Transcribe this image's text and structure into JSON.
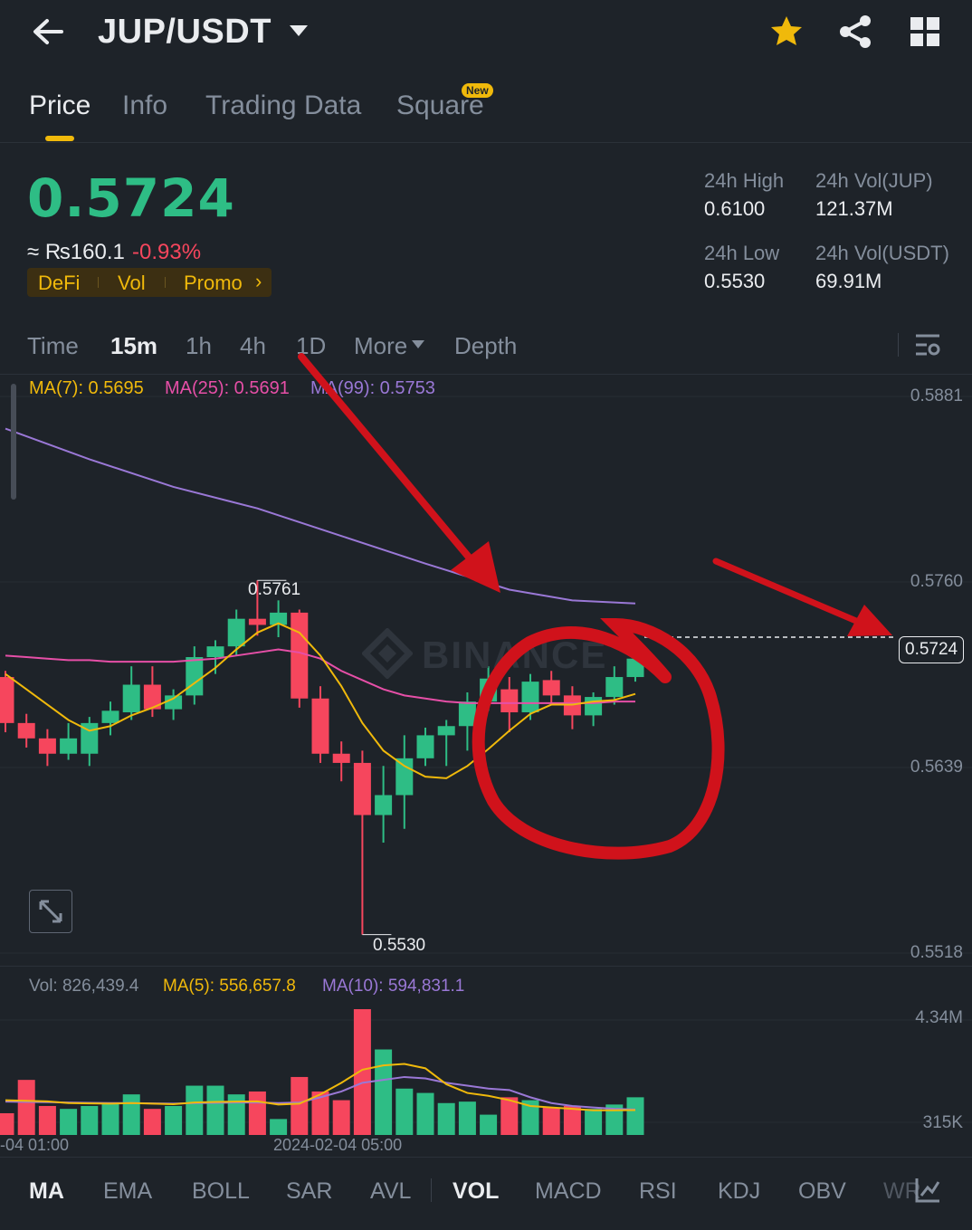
{
  "header": {
    "title": "JUP/USDT"
  },
  "tabs": [
    {
      "label": "Price",
      "active": true
    },
    {
      "label": "Info"
    },
    {
      "label": "Trading Data"
    },
    {
      "label": "Square",
      "badge": "New"
    }
  ],
  "ticker": {
    "price": "0.5724",
    "fiat": "≈ ₨160.1",
    "change": "-0.93%",
    "tags": [
      "DeFi",
      "Vol",
      "Promo"
    ],
    "high_label": "24h High",
    "high": "0.6100",
    "low_label": "24h Low",
    "low": "0.5530",
    "vol_jup_label": "24h Vol(JUP)",
    "vol_jup": "121.37M",
    "vol_usdt_label": "24h Vol(USDT)",
    "vol_usdt": "69.91M"
  },
  "timeframes": [
    "Time",
    "15m",
    "1h",
    "4h",
    "1D",
    "More",
    "Depth"
  ],
  "active_timeframe": "15m",
  "ma_legend": {
    "ma7": "MA(7): 0.5695",
    "ma25": "MA(25): 0.5691",
    "ma99": "MA(99): 0.5753"
  },
  "price_axis": [
    "0.5881",
    "0.5760",
    "0.5639",
    "0.5518"
  ],
  "current_price_tag": "0.5724",
  "high_marker": "0.5761",
  "low_marker": "0.5530",
  "watermark": "BINANCE",
  "vol_legend": {
    "vol": "Vol: 826,439.4",
    "ma5": "MA(5): 556,657.8",
    "ma10": "MA(10): 594,831.1"
  },
  "vol_axis": [
    "4.34M",
    "315K"
  ],
  "time_axis": [
    "-04 01:00",
    "2024-02-04 05:00"
  ],
  "indicators": [
    "MA",
    "EMA",
    "BOLL",
    "SAR",
    "AVL",
    "VOL",
    "MACD",
    "RSI",
    "KDJ",
    "OBV",
    "WR"
  ],
  "colors": {
    "up": "#2ebd85",
    "down": "#f6465d",
    "accent": "#f0b90b",
    "ma7": "#f0b90b",
    "ma25": "#e64fa7",
    "ma99": "#9a78d6",
    "annotation": "#d0121b"
  },
  "chart_data": {
    "type": "candlestick",
    "title": "",
    "interval": "15m",
    "ylim": [
      0.5518,
      0.5881
    ],
    "candles": [
      {
        "o": 0.5698,
        "h": 0.5702,
        "l": 0.5662,
        "c": 0.5668
      },
      {
        "o": 0.5668,
        "h": 0.5674,
        "l": 0.5652,
        "c": 0.5658
      },
      {
        "o": 0.5658,
        "h": 0.5664,
        "l": 0.564,
        "c": 0.5648
      },
      {
        "o": 0.5648,
        "h": 0.5668,
        "l": 0.5644,
        "c": 0.5658
      },
      {
        "o": 0.5648,
        "h": 0.5672,
        "l": 0.564,
        "c": 0.5668
      },
      {
        "o": 0.5668,
        "h": 0.5682,
        "l": 0.566,
        "c": 0.5676
      },
      {
        "o": 0.5675,
        "h": 0.5705,
        "l": 0.567,
        "c": 0.5693
      },
      {
        "o": 0.5693,
        "h": 0.5705,
        "l": 0.5672,
        "c": 0.5677
      },
      {
        "o": 0.5677,
        "h": 0.569,
        "l": 0.567,
        "c": 0.5686
      },
      {
        "o": 0.5686,
        "h": 0.5718,
        "l": 0.568,
        "c": 0.5711
      },
      {
        "o": 0.5711,
        "h": 0.5722,
        "l": 0.57,
        "c": 0.5718
      },
      {
        "o": 0.5718,
        "h": 0.5742,
        "l": 0.5712,
        "c": 0.5736
      },
      {
        "o": 0.5736,
        "h": 0.5761,
        "l": 0.5725,
        "c": 0.5732
      },
      {
        "o": 0.5732,
        "h": 0.5748,
        "l": 0.5724,
        "c": 0.574
      },
      {
        "o": 0.574,
        "h": 0.5742,
        "l": 0.5678,
        "c": 0.5684
      },
      {
        "o": 0.5684,
        "h": 0.5692,
        "l": 0.5642,
        "c": 0.5648
      },
      {
        "o": 0.5648,
        "h": 0.5656,
        "l": 0.563,
        "c": 0.5642
      },
      {
        "o": 0.5642,
        "h": 0.565,
        "l": 0.553,
        "c": 0.5608
      },
      {
        "o": 0.5608,
        "h": 0.564,
        "l": 0.559,
        "c": 0.5621
      },
      {
        "o": 0.5621,
        "h": 0.566,
        "l": 0.5599,
        "c": 0.5645
      },
      {
        "o": 0.5645,
        "h": 0.5665,
        "l": 0.564,
        "c": 0.566
      },
      {
        "o": 0.566,
        "h": 0.567,
        "l": 0.564,
        "c": 0.5666
      },
      {
        "o": 0.5666,
        "h": 0.5688,
        "l": 0.565,
        "c": 0.5682
      },
      {
        "o": 0.5682,
        "h": 0.5705,
        "l": 0.5676,
        "c": 0.5697
      },
      {
        "o": 0.569,
        "h": 0.5698,
        "l": 0.5662,
        "c": 0.5675
      },
      {
        "o": 0.5675,
        "h": 0.57,
        "l": 0.567,
        "c": 0.5695
      },
      {
        "o": 0.5696,
        "h": 0.5702,
        "l": 0.568,
        "c": 0.5686
      },
      {
        "o": 0.5686,
        "h": 0.5692,
        "l": 0.5664,
        "c": 0.5673
      },
      {
        "o": 0.5673,
        "h": 0.5688,
        "l": 0.5666,
        "c": 0.5685
      },
      {
        "o": 0.5685,
        "h": 0.5705,
        "l": 0.568,
        "c": 0.5698
      },
      {
        "o": 0.5698,
        "h": 0.5712,
        "l": 0.5695,
        "c": 0.571
      }
    ],
    "ma7": [
      0.57,
      0.569,
      0.568,
      0.567,
      0.5663,
      0.5666,
      0.5673,
      0.5678,
      0.5684,
      0.5694,
      0.5704,
      0.5716,
      0.5727,
      0.5733,
      0.5727,
      0.5712,
      0.5692,
      0.5668,
      0.565,
      0.564,
      0.5633,
      0.5632,
      0.564,
      0.5651,
      0.5663,
      0.5674,
      0.568,
      0.568,
      0.5682,
      0.5683,
      0.5687
    ],
    "ma25": [
      0.5712,
      0.5711,
      0.571,
      0.5709,
      0.5709,
      0.5708,
      0.5708,
      0.5708,
      0.5708,
      0.5709,
      0.571,
      0.5712,
      0.5714,
      0.5716,
      0.5714,
      0.571,
      0.5702,
      0.5696,
      0.569,
      0.5686,
      0.5684,
      0.5682,
      0.5681,
      0.5681,
      0.5681,
      0.5681,
      0.5681,
      0.5681,
      0.5681,
      0.5682,
      0.5682
    ],
    "ma99_points": [
      [
        0,
        0.586
      ],
      [
        4,
        0.584
      ],
      [
        8,
        0.5822
      ],
      [
        12,
        0.5808
      ],
      [
        16,
        0.579
      ],
      [
        20,
        0.5772
      ],
      [
        24,
        0.5755
      ],
      [
        27,
        0.5748
      ],
      [
        30,
        0.5746
      ]
    ],
    "volume": {
      "ylim": [
        0,
        4340000
      ],
      "values": [
        750000,
        1900000,
        1000000,
        900000,
        1000000,
        1100000,
        1400000,
        900000,
        1000000,
        1700000,
        1700000,
        1400000,
        1500000,
        550000,
        2000000,
        1500000,
        1200000,
        4340000,
        2950000,
        1600000,
        1450000,
        1100000,
        1150000,
        700000,
        1300000,
        1200000,
        950000,
        1000000,
        900000,
        1050000,
        1300000
      ],
      "ma5": [
        1200000,
        1180000,
        1160000,
        1100000,
        1090000,
        1080000,
        1100000,
        1080000,
        1060000,
        1120000,
        1140000,
        1150000,
        1160000,
        1050000,
        1080000,
        1400000,
        1800000,
        2250000,
        2400000,
        2450000,
        2300000,
        1750000,
        1450000,
        1350000,
        1200000,
        1000000,
        950000,
        900000,
        850000,
        850000,
        860000
      ],
      "ma10": [
        1150000,
        1140000,
        1130000,
        1120000,
        1110000,
        1100000,
        1100000,
        1090000,
        1080000,
        1100000,
        1110000,
        1120000,
        1120000,
        1100000,
        1120000,
        1300000,
        1500000,
        1800000,
        1900000,
        2000000,
        1950000,
        1800000,
        1700000,
        1600000,
        1550000,
        1300000,
        1100000,
        1000000,
        950000,
        900000,
        880000
      ]
    }
  }
}
